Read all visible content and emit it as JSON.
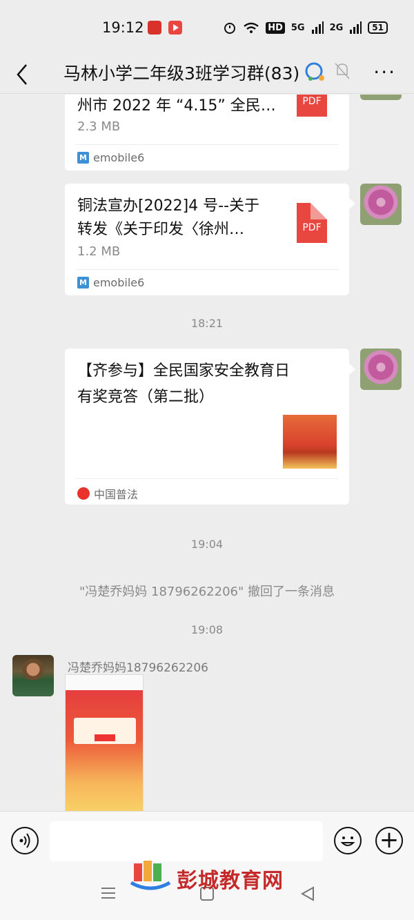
{
  "status_bar": {
    "time": "19:12",
    "network_5g": "5G",
    "network_2g": "2G",
    "hd_label": "HD",
    "battery": "51"
  },
  "header": {
    "title": "马林小学二年级3班学习群(83)",
    "back_icon": "chevron-left-icon",
    "more_label": "···"
  },
  "messages": {
    "file1": {
      "title": "州市 2022 年 “4.15” 全民…",
      "size": "2.3 MB",
      "source": "emobile6",
      "file_type": "PDF"
    },
    "file2": {
      "title_line1": "铜法宣办[2022]4 号--关于",
      "title_line2": "转发《关于印发〈徐州…",
      "size": "1.2 MB",
      "source": "emobile6",
      "file_type": "PDF"
    },
    "time_1821": "18:21",
    "article": {
      "title_line1": "【齐参与】全民国家安全教育日",
      "title_line2": "有奖竞答（第二批）",
      "source": "中国普法"
    },
    "time_1904": "19:04",
    "recall_notice": "\"冯楚乔妈妈 18796262206\" 撤回了一条消息",
    "time_1908": "19:08",
    "sender": "冯楚乔妈妈18796262206"
  },
  "watermark": {
    "text": "彭城教育网"
  },
  "colors": {
    "background": "#ededed",
    "bubble": "#ffffff",
    "pdf_red": "#e8473f",
    "watermark_red": "#c42a2a"
  }
}
